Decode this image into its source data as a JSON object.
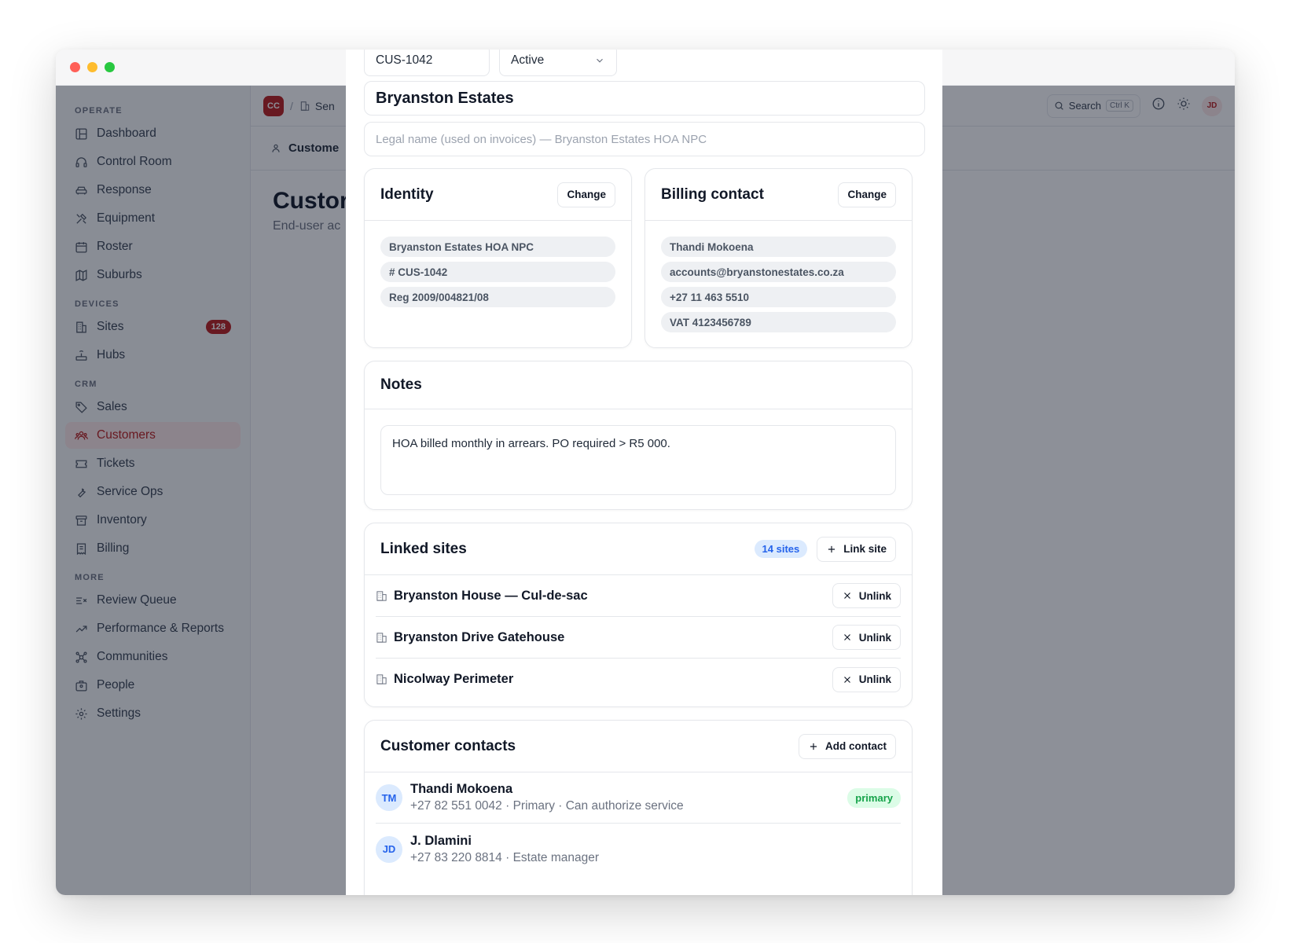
{
  "sidebar": {
    "sections": [
      "OPERATE",
      "DEVICES",
      "CRM",
      "MORE"
    ],
    "items": [
      {
        "label": "Dashboard",
        "icon": "dashboard-icon"
      },
      {
        "label": "Control Room",
        "icon": "headset-icon"
      },
      {
        "label": "Response",
        "icon": "car-icon"
      },
      {
        "label": "Equipment",
        "icon": "tools-icon"
      },
      {
        "label": "Roster",
        "icon": "calendar-icon"
      },
      {
        "label": "Suburbs",
        "icon": "map-icon"
      },
      {
        "label": "Sites",
        "icon": "building-icon",
        "badge": "128"
      },
      {
        "label": "Hubs",
        "icon": "router-icon"
      },
      {
        "label": "Sales",
        "icon": "tag-icon"
      },
      {
        "label": "Customers",
        "icon": "users-icon"
      },
      {
        "label": "Tickets",
        "icon": "ticket-icon"
      },
      {
        "label": "Service Ops",
        "icon": "wrench-icon"
      },
      {
        "label": "Inventory",
        "icon": "archive-icon"
      },
      {
        "label": "Billing",
        "icon": "receipt-icon"
      },
      {
        "label": "Review Queue",
        "icon": "review-icon"
      },
      {
        "label": "Performance & Reports",
        "icon": "chart-icon"
      },
      {
        "label": "Communities",
        "icon": "network-icon"
      },
      {
        "label": "People",
        "icon": "people-icon"
      },
      {
        "label": "Settings",
        "icon": "gear-icon"
      }
    ],
    "active": "Customers"
  },
  "topbar": {
    "org_initials": "CC",
    "crumb_sep": "/",
    "crumb": "Sen",
    "search_label": "Search",
    "search_kbd": "Ctrl K",
    "user_initials": "JD"
  },
  "tabbar": {
    "label": "Custome"
  },
  "page": {
    "title": "Custor",
    "subtitle": "End-user ac"
  },
  "modal": {
    "code": "CUS-1042",
    "status": "Active",
    "name": "Bryanston Estates",
    "legal_placeholder": "Legal name (used on invoices) — Bryanston Estates HOA NPC",
    "identity": {
      "title": "Identity",
      "change_label": "Change",
      "pills": [
        "Bryanston Estates HOA NPC",
        "# CUS-1042",
        "Reg 2009/004821/08"
      ]
    },
    "billing": {
      "title": "Billing contact",
      "change_label": "Change",
      "pills": [
        "Thandi Mokoena",
        "accounts@bryanstonestates.co.za",
        "+27 11 463 5510",
        "VAT 4123456789"
      ]
    },
    "notes": {
      "title": "Notes",
      "text": "HOA billed monthly in arrears. PO required > R5 000."
    },
    "linked_sites": {
      "title": "Linked sites",
      "count": "14 sites",
      "link_label": "Link site",
      "unlink_label": "Unlink",
      "sites": [
        "Bryanston House — Cul-de-sac",
        "Bryanston Drive Gatehouse",
        "Nicolway Perimeter"
      ]
    },
    "contacts": {
      "title": "Customer contacts",
      "add_label": "Add contact",
      "items": [
        {
          "initials": "TM",
          "name": "Thandi Mokoena",
          "meta": "+27 82 551 0042 · Primary · Can authorize service",
          "badge": "primary"
        },
        {
          "initials": "JD",
          "name": "J. Dlamini",
          "meta": "+27 83 220 8814 · Estate manager",
          "badge": ""
        }
      ]
    }
  },
  "colors": {
    "accent": "#b91c1c",
    "info": "#2563eb",
    "success": "#16a34a"
  }
}
